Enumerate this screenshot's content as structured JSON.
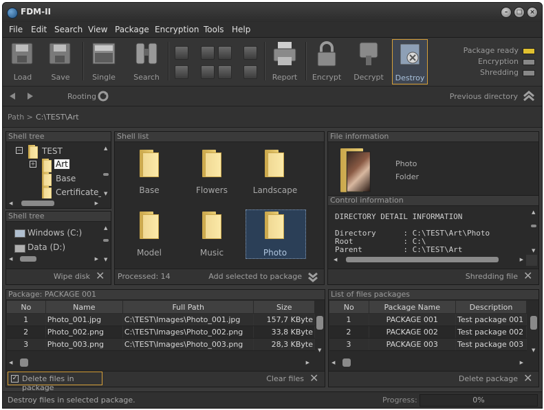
{
  "window": {
    "title": "FDM-II"
  },
  "menu": [
    "File",
    "Edit",
    "Search",
    "View",
    "Package",
    "Encryption",
    "Tools",
    "Help"
  ],
  "toolbar": {
    "load": "Load",
    "save": "Save",
    "single": "Single",
    "search": "Search",
    "report": "Report",
    "encrypt": "Encrypt",
    "decrypt": "Decrypt",
    "destroy": "Destroy"
  },
  "status_indicators": [
    {
      "label": "Package ready",
      "color": "#e0c030"
    },
    {
      "label": "Encryption",
      "color": "#888888"
    },
    {
      "label": "Shredding",
      "color": "#888888"
    }
  ],
  "nav": {
    "rooting": "Rooting",
    "previous": "Previous directory"
  },
  "path": {
    "label": "Path >",
    "value": "C:\\TEST\\Art"
  },
  "shell_tree_1": {
    "title": "Shell tree",
    "items": [
      "TEST",
      "Art",
      "Base",
      "Certificate_"
    ]
  },
  "shell_tree_2": {
    "title": "Shell tree",
    "items": [
      "Windows (C:)",
      "Data (D:)"
    ],
    "footer": "Wipe disk"
  },
  "shell_list": {
    "title": "Shell list",
    "folders": [
      "Base",
      "Flowers",
      "Landscape",
      "Model",
      "Music",
      "Photo"
    ],
    "processed": "Processed: 14",
    "add": "Add selected to package"
  },
  "file_info": {
    "title": "File information",
    "name": "Photo",
    "type": "Folder"
  },
  "control_info": {
    "title": "Control information",
    "heading": "DIRECTORY DETAIL INFORMATION",
    "lines": [
      "Directory      : C:\\TEST\\Art\\Photo",
      "Root           : C:\\",
      "Parent         : C:\\TEST\\Art"
    ],
    "footer": "Shredding file"
  },
  "package": {
    "title": "Package: PACKAGE 001",
    "columns": [
      "No",
      "Name",
      "Full Path",
      "Size"
    ],
    "rows": [
      [
        "1",
        "Photo_001.jpg",
        "C:\\TEST\\Images\\Photo_001.jpg",
        "157,7 KByte"
      ],
      [
        "2",
        "Photo_002.png",
        "C:\\TEST\\Images\\Photo_002.png",
        "33,8 KByte"
      ],
      [
        "3",
        "Photo_003.png",
        "C:\\TEST\\Images\\Photo_003.png",
        "28,3 KByte"
      ]
    ],
    "checkbox": "Delete files in package",
    "clear": "Clear files"
  },
  "packages_list": {
    "title": "List of files packages",
    "columns": [
      "No",
      "Package Name",
      "Description"
    ],
    "rows": [
      [
        "1",
        "PACKAGE 001",
        "Test package 001"
      ],
      [
        "2",
        "PACKAGE 002",
        "Test package 002"
      ],
      [
        "3",
        "PACKAGE 003",
        "Test package 003"
      ]
    ],
    "delete": "Delete package"
  },
  "statusbar": {
    "message": "Destroy files in selected package.",
    "progress_label": "Progress:",
    "progress_value": "0%"
  }
}
